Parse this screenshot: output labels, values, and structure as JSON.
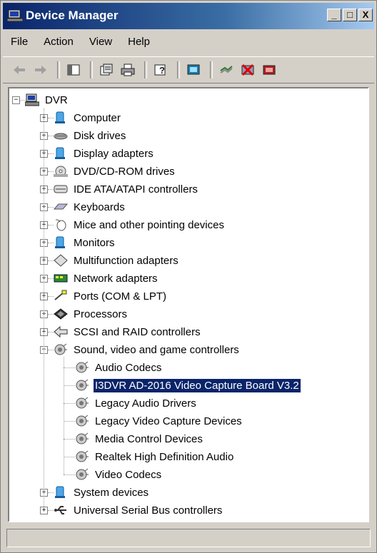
{
  "window": {
    "title": "Device Manager",
    "buttons": [
      "_",
      "□",
      "X"
    ]
  },
  "menu": [
    "File",
    "Action",
    "View",
    "Help"
  ],
  "toolbar": {
    "buttons": [
      "back-arrow-icon",
      "forward-arrow-icon",
      "|",
      "console-tree-icon",
      "|",
      "properties-icon",
      "print-icon",
      "|",
      "help-icon",
      "|",
      "scan-hardware-icon",
      "|",
      "update-driver-icon",
      "disable-icon",
      "uninstall-icon"
    ]
  },
  "tree": {
    "root": "DVR",
    "categories": [
      {
        "label": "Computer",
        "icon": "computer-icon"
      },
      {
        "label": "Disk drives",
        "icon": "disk-icon"
      },
      {
        "label": "Display adapters",
        "icon": "display-icon"
      },
      {
        "label": "DVD/CD-ROM drives",
        "icon": "cd-icon"
      },
      {
        "label": "IDE ATA/ATAPI controllers",
        "icon": "ide-icon"
      },
      {
        "label": "Keyboards",
        "icon": "keyboard-icon"
      },
      {
        "label": "Mice and other pointing devices",
        "icon": "mouse-icon"
      },
      {
        "label": "Monitors",
        "icon": "monitor-icon"
      },
      {
        "label": "Multifunction adapters",
        "icon": "multifunction-icon"
      },
      {
        "label": "Network adapters",
        "icon": "network-icon"
      },
      {
        "label": "Ports (COM & LPT)",
        "icon": "port-icon"
      },
      {
        "label": "Processors",
        "icon": "processor-icon"
      },
      {
        "label": "SCSI and RAID controllers",
        "icon": "scsi-icon"
      },
      {
        "label": "Sound, video and game controllers",
        "icon": "sound-icon",
        "expanded": true,
        "children": [
          {
            "label": "Audio Codecs"
          },
          {
            "label": "I3DVR AD-2016 Video Capture Board V3.2",
            "selected": true
          },
          {
            "label": "Legacy Audio Drivers"
          },
          {
            "label": "Legacy Video Capture Devices"
          },
          {
            "label": "Media Control Devices"
          },
          {
            "label": "Realtek High Definition Audio"
          },
          {
            "label": "Video Codecs"
          }
        ]
      },
      {
        "label": "System devices",
        "icon": "system-icon"
      },
      {
        "label": "Universal Serial Bus controllers",
        "icon": "usb-icon"
      }
    ]
  },
  "colors": {
    "titlebar_start": "#0a246a",
    "titlebar_end": "#a6caf0",
    "selection": "#0a246a",
    "chrome": "#d4d0c8"
  }
}
